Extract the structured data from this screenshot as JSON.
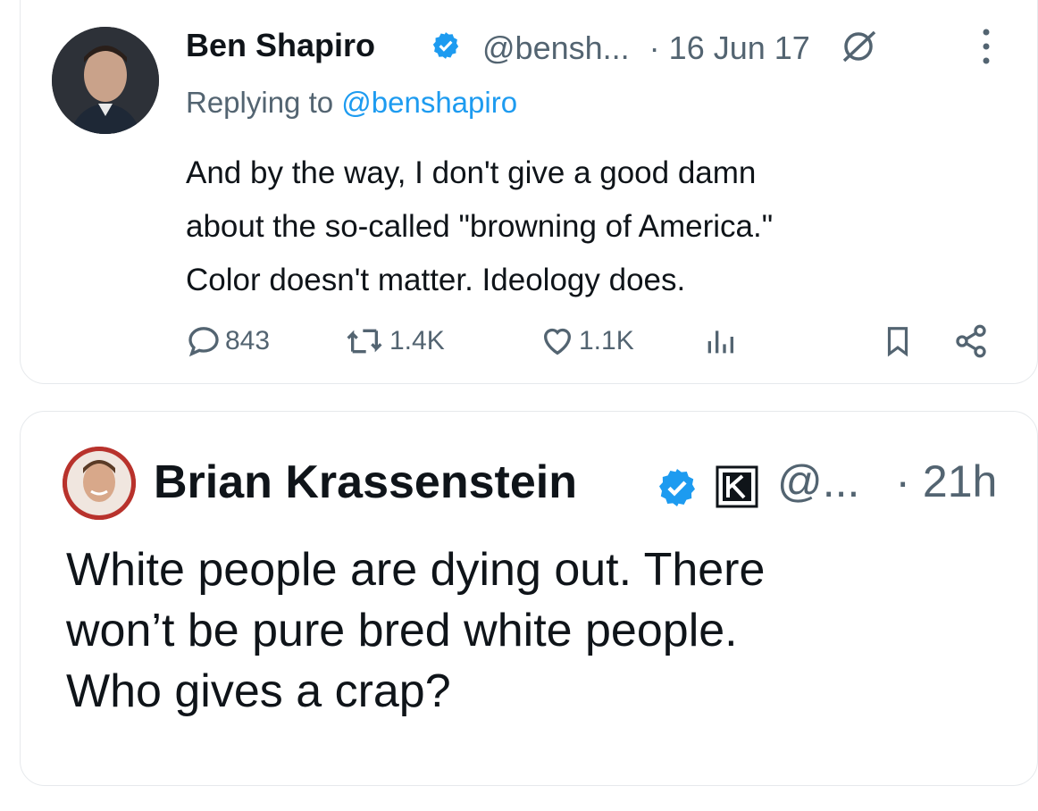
{
  "tweet1": {
    "display_name": "Ben Shapiro",
    "handle": "@bensh...",
    "separator": "·",
    "date": "16 Jun 17",
    "replying_prefix": "Replying to ",
    "replying_handle": "@benshapiro",
    "text_lines": [
      "And by the way, I don't give a good damn",
      "about the so-called \"browning of America.\"",
      "Color doesn't matter. Ideology does."
    ],
    "replies": "843",
    "retweets": "1.4K",
    "likes": "1.1K",
    "icons": {
      "verified": "verified-badge-icon",
      "grok": "grok-icon",
      "more": "more-options-icon",
      "reply": "reply-icon",
      "retweet": "retweet-icon",
      "like": "heart-icon",
      "views": "views-chart-icon",
      "bookmark": "bookmark-icon",
      "share": "share-icon"
    }
  },
  "tweet2": {
    "display_name": "Brian Krassenstein",
    "handle": "@...",
    "separator": "·",
    "time": "21h",
    "text_lines": [
      "White people are dying out. There",
      "won’t be pure bred white people.",
      "Who gives a crap?"
    ],
    "icons": {
      "verified": "verified-badge-icon",
      "affiliate": "k-affiliate-badge-icon"
    }
  },
  "colors": {
    "accent": "#1d9bf0",
    "text": "#0f1419",
    "secondary": "#536471",
    "border": "#e6e9ec"
  }
}
